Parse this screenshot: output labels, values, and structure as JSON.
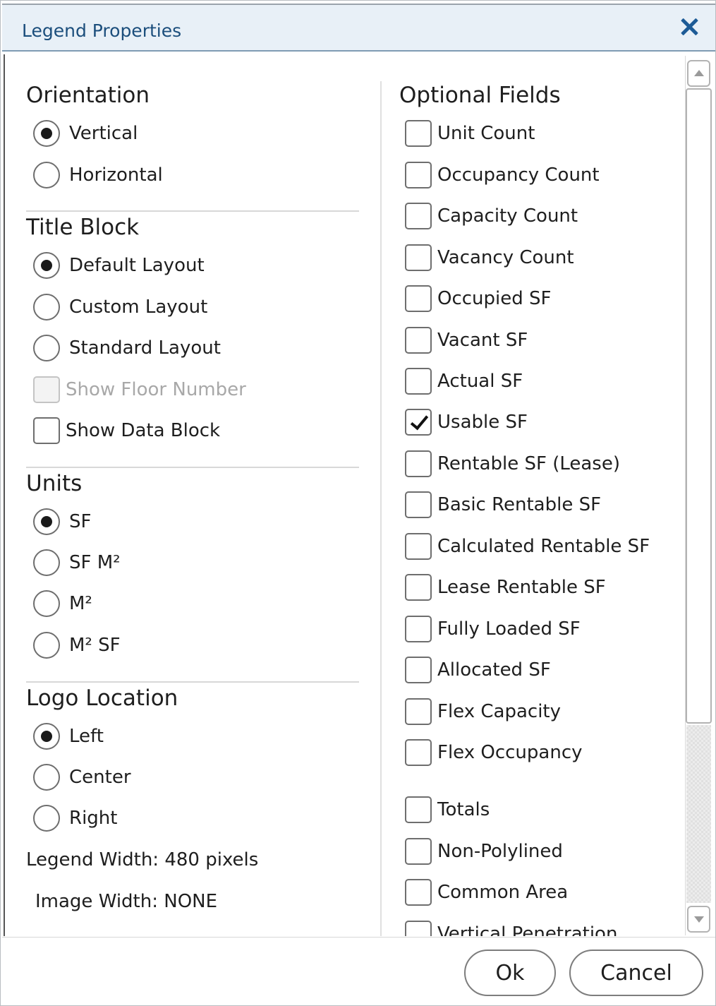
{
  "dialog": {
    "title": "Legend Properties"
  },
  "orientation": {
    "title": "Orientation",
    "options": [
      {
        "label": "Vertical",
        "selected": true
      },
      {
        "label": "Horizontal",
        "selected": false
      }
    ]
  },
  "title_block": {
    "title": "Title Block",
    "options": [
      {
        "label": "Default Layout",
        "selected": true
      },
      {
        "label": "Custom Layout",
        "selected": false
      },
      {
        "label": "Standard Layout",
        "selected": false
      }
    ],
    "checkboxes": [
      {
        "label": "Show Floor Number",
        "checked": false,
        "disabled": true
      },
      {
        "label": "Show Data Block",
        "checked": false,
        "disabled": false
      }
    ]
  },
  "units": {
    "title": "Units",
    "options": [
      {
        "label": "SF",
        "selected": true
      },
      {
        "label": "SF M²",
        "selected": false
      },
      {
        "label": "M²",
        "selected": false
      },
      {
        "label": "M² SF",
        "selected": false
      }
    ]
  },
  "logo_location": {
    "title": "Logo Location",
    "options": [
      {
        "label": "Left",
        "selected": true
      },
      {
        "label": "Center",
        "selected": false
      },
      {
        "label": "Right",
        "selected": false
      }
    ]
  },
  "info": {
    "legend_width": "Legend Width: 480 pixels",
    "image_width": "Image Width: NONE"
  },
  "optional_fields": {
    "title": "Optional Fields",
    "fields": [
      {
        "label": "Unit Count",
        "checked": false
      },
      {
        "label": "Occupancy Count",
        "checked": false
      },
      {
        "label": "Capacity Count",
        "checked": false
      },
      {
        "label": "Vacancy Count",
        "checked": false
      },
      {
        "label": "Occupied SF",
        "checked": false
      },
      {
        "label": "Vacant SF",
        "checked": false
      },
      {
        "label": "Actual SF",
        "checked": false
      },
      {
        "label": "Usable SF",
        "checked": true
      },
      {
        "label": "Rentable SF (Lease)",
        "checked": false
      },
      {
        "label": "Basic Rentable SF",
        "checked": false
      },
      {
        "label": "Calculated Rentable SF",
        "checked": false
      },
      {
        "label": "Lease Rentable SF",
        "checked": false
      },
      {
        "label": "Fully Loaded SF",
        "checked": false
      },
      {
        "label": "Allocated SF",
        "checked": false
      },
      {
        "label": "Flex Capacity",
        "checked": false
      },
      {
        "label": "Flex Occupancy",
        "checked": false
      }
    ],
    "extra_fields": [
      {
        "label": "Totals",
        "checked": false
      },
      {
        "label": "Non-Polylined",
        "checked": false
      },
      {
        "label": "Common Area",
        "checked": false
      },
      {
        "label": "Vertical Penetration",
        "checked": false
      }
    ]
  },
  "footer": {
    "ok_label": "Ok",
    "cancel_label": "Cancel"
  }
}
